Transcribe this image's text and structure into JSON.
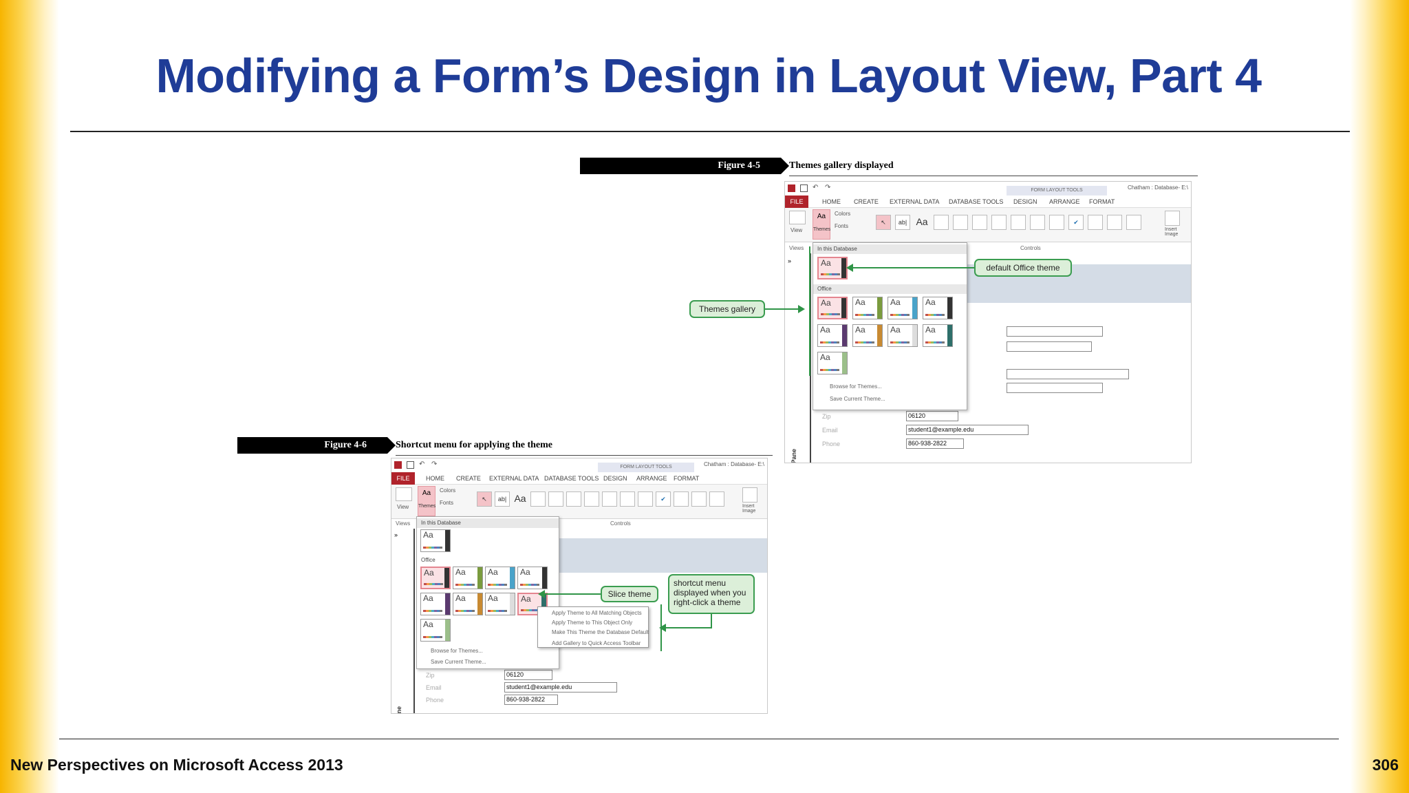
{
  "slide": {
    "title": "Modifying a Form’s Design in Layout View, Part 4",
    "footer_left": "New Perspectives on Microsoft Access 2013",
    "page_number": "306"
  },
  "colors": {
    "title": "#1f3c97",
    "accent_edge": "#f7b400",
    "callout_border": "#3a9c4f",
    "callout_fill": "#dcefd9"
  },
  "figures": [
    {
      "label": "Figure 4-5",
      "caption": "Themes gallery displayed",
      "window": {
        "context_group": "FORM LAYOUT TOOLS",
        "window_title": "Chatham : Database- E:\\",
        "file_tab": "FILE",
        "tabs": [
          "HOME",
          "CREATE",
          "EXTERNAL DATA",
          "DATABASE TOOLS",
          "DESIGN",
          "ARRANGE",
          "FORMAT"
        ],
        "view_label": "View",
        "themes_label": "Themes",
        "colors_label": "Colors",
        "fonts_label": "Fonts",
        "views_group": "Views",
        "controls_group": "Controls",
        "insert_image": "Insert Image",
        "nav_pane": "Navigation Pane",
        "gallery_section_db": "In this Database",
        "gallery_section_office": "Office",
        "tile_text": "Aa",
        "browse": "Browse for Themes...",
        "save": "Save Current Theme...",
        "fields": [
          {
            "label": "Zip",
            "value": "06120"
          },
          {
            "label": "Email",
            "value": "student1@example.edu"
          },
          {
            "label": "Phone",
            "value": "860-938-2822"
          }
        ]
      },
      "callouts": [
        "default Office theme",
        "Themes gallery"
      ]
    },
    {
      "label": "Figure 4-6",
      "caption": "Shortcut menu for applying the theme",
      "window": {
        "context_group": "FORM LAYOUT TOOLS",
        "window_title": "Chatham : Database- E:\\",
        "file_tab": "FILE",
        "tabs": [
          "HOME",
          "CREATE",
          "EXTERNAL DATA",
          "DATABASE TOOLS",
          "DESIGN",
          "ARRANGE",
          "FORMAT"
        ],
        "view_label": "View",
        "themes_label": "Themes",
        "colors_label": "Colors",
        "fonts_label": "Fonts",
        "views_group": "Views",
        "controls_group": "Controls",
        "insert_image": "Insert Image",
        "nav_pane": "Navigation Pane",
        "gallery_section_db": "In this Database",
        "gallery_section_office": "Office",
        "tile_text": "Aa",
        "browse": "Browse for Themes...",
        "save": "Save Current Theme...",
        "shortcut_menu": [
          "Apply Theme to All Matching Objects",
          "Apply Theme to This Object Only",
          "Make This Theme the Database Default",
          "Add Gallery to Quick Access Toolbar"
        ],
        "fields": [
          {
            "label": "Zip",
            "value": "06120"
          },
          {
            "label": "Email",
            "value": "student1@example.edu"
          },
          {
            "label": "Phone",
            "value": "860-938-2822"
          }
        ]
      },
      "callouts": [
        "Slice theme",
        "shortcut menu displayed when you right-click a theme"
      ]
    }
  ]
}
